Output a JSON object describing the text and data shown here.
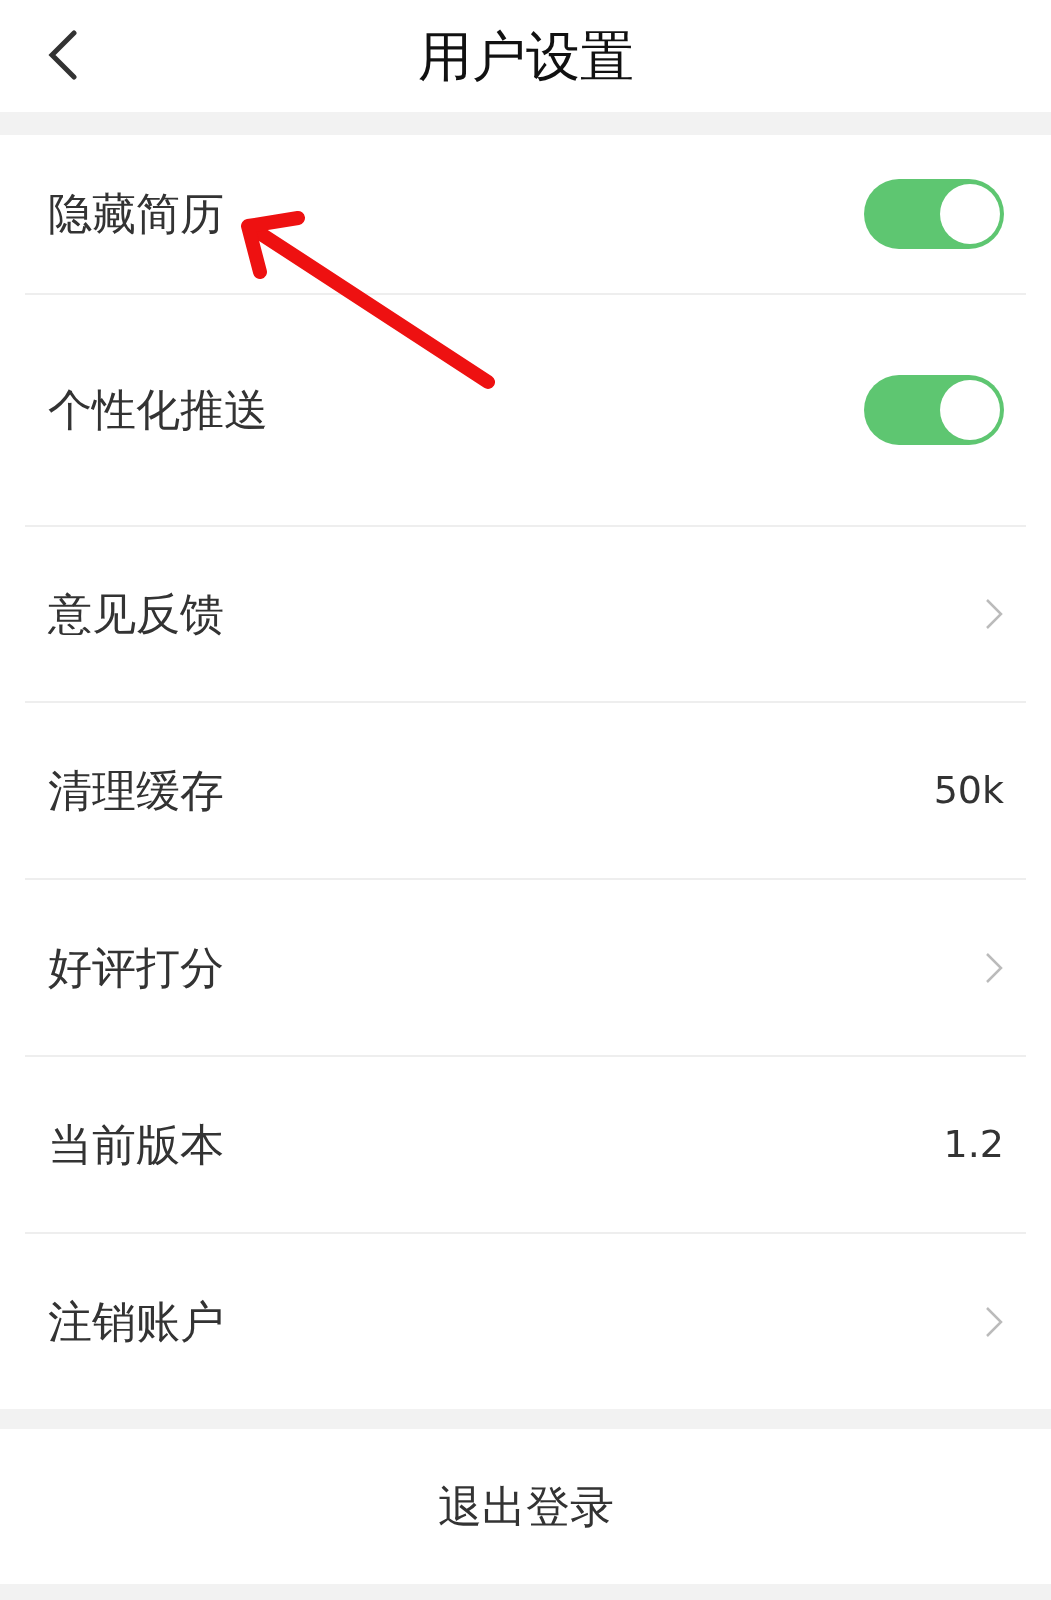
{
  "header": {
    "title": "用户设置"
  },
  "rows": [
    {
      "kind": "toggle",
      "label": "隐藏简历",
      "on": true
    },
    {
      "kind": "toggle",
      "label": "个性化推送",
      "on": true
    },
    {
      "kind": "link",
      "label": "意见反馈"
    },
    {
      "kind": "value",
      "label": "清理缓存",
      "value": "50k"
    },
    {
      "kind": "link",
      "label": "好评打分"
    },
    {
      "kind": "value",
      "label": "当前版本",
      "value": "1.2"
    },
    {
      "kind": "link",
      "label": "注销账户"
    }
  ],
  "logout": {
    "label": "退出登录"
  }
}
